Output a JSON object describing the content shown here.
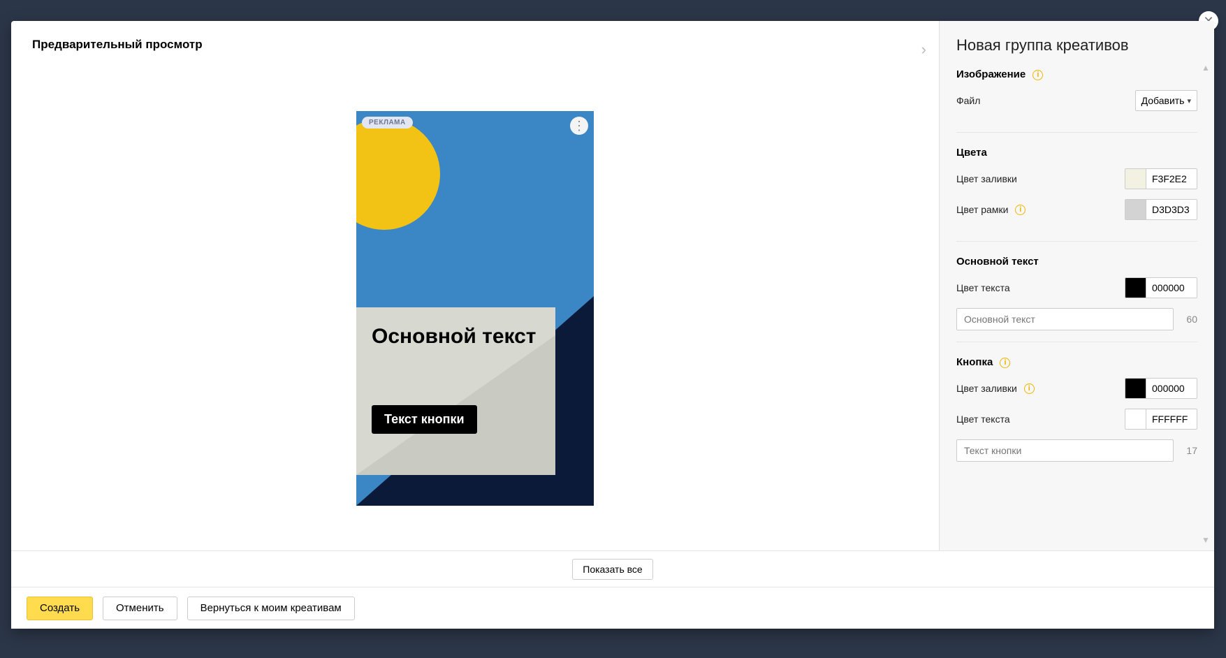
{
  "preview": {
    "title": "Предварительный просмотр"
  },
  "banner": {
    "ad_badge": "РЕКЛАМА",
    "main_text": "Основной текст",
    "button_text": "Текст кнопки"
  },
  "settings": {
    "title": "Новая группа креативов",
    "image_section": {
      "title": "Изображение",
      "file_label": "Файл",
      "add_button": "Добавить"
    },
    "colors_section": {
      "title": "Цвета",
      "fill_label": "Цвет заливки",
      "fill_value": "F3F2E2",
      "border_label": "Цвет рамки",
      "border_value": "D3D3D3"
    },
    "maintext_section": {
      "title": "Основной текст",
      "text_color_label": "Цвет текста",
      "text_color_value": "000000",
      "input_placeholder": "Основной текст",
      "counter": "60"
    },
    "button_section": {
      "title": "Кнопка",
      "fill_label": "Цвет заливки",
      "fill_value": "000000",
      "text_color_label": "Цвет текста",
      "text_color_value": "FFFFFF",
      "input_placeholder": "Текст кнопки",
      "counter": "17"
    }
  },
  "middle": {
    "show_all": "Показать все"
  },
  "footer": {
    "create": "Создать",
    "cancel": "Отменить",
    "back": "Вернуться к моим креативам"
  },
  "colors": {
    "fill_hex": "#F3F2E2",
    "border_hex": "#D3D3D3",
    "maintext_hex": "#000000",
    "btn_fill_hex": "#000000",
    "btn_text_hex": "#FFFFFF"
  }
}
